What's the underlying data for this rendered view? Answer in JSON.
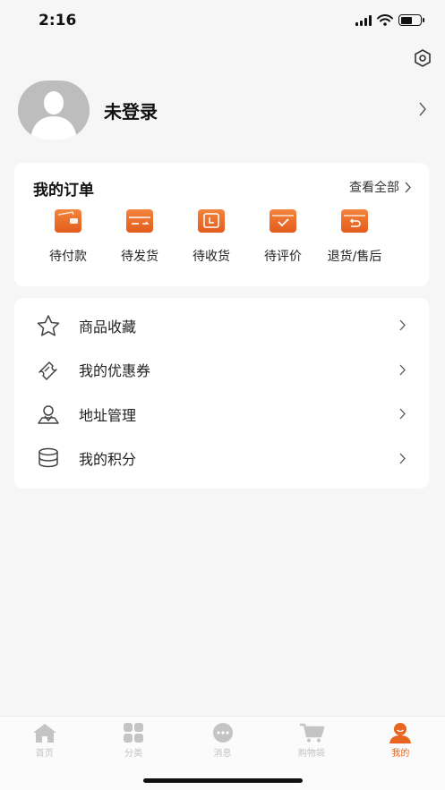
{
  "status_bar": {
    "time": "2:16"
  },
  "profile": {
    "login_text": "未登录"
  },
  "orders": {
    "title": "我的订单",
    "view_all": "查看全部",
    "items": [
      {
        "label": "待付款",
        "icon": "wallet-icon"
      },
      {
        "label": "待发货",
        "icon": "card-ship-icon"
      },
      {
        "label": "待收货",
        "icon": "box-receive-icon"
      },
      {
        "label": "待评价",
        "icon": "box-check-icon"
      },
      {
        "label": "退货/售后",
        "icon": "box-return-icon"
      }
    ]
  },
  "menu": {
    "items": [
      {
        "label": "商品收藏",
        "icon": "star-icon"
      },
      {
        "label": "我的优惠券",
        "icon": "coupon-icon"
      },
      {
        "label": "地址管理",
        "icon": "location-icon"
      },
      {
        "label": "我的积分",
        "icon": "coins-icon"
      }
    ]
  },
  "tabbar": {
    "tabs": [
      {
        "label": "首页",
        "icon": "home-icon",
        "active": false
      },
      {
        "label": "分类",
        "icon": "grid-icon",
        "active": false
      },
      {
        "label": "消息",
        "icon": "message-icon",
        "active": false
      },
      {
        "label": "购物袋",
        "icon": "cart-icon",
        "active": false
      },
      {
        "label": "我的",
        "icon": "profile-icon",
        "active": true
      }
    ]
  },
  "colors": {
    "accent": "#e8651f",
    "icon_gray": "#c4c4c4",
    "background": "#f6f6f6"
  }
}
